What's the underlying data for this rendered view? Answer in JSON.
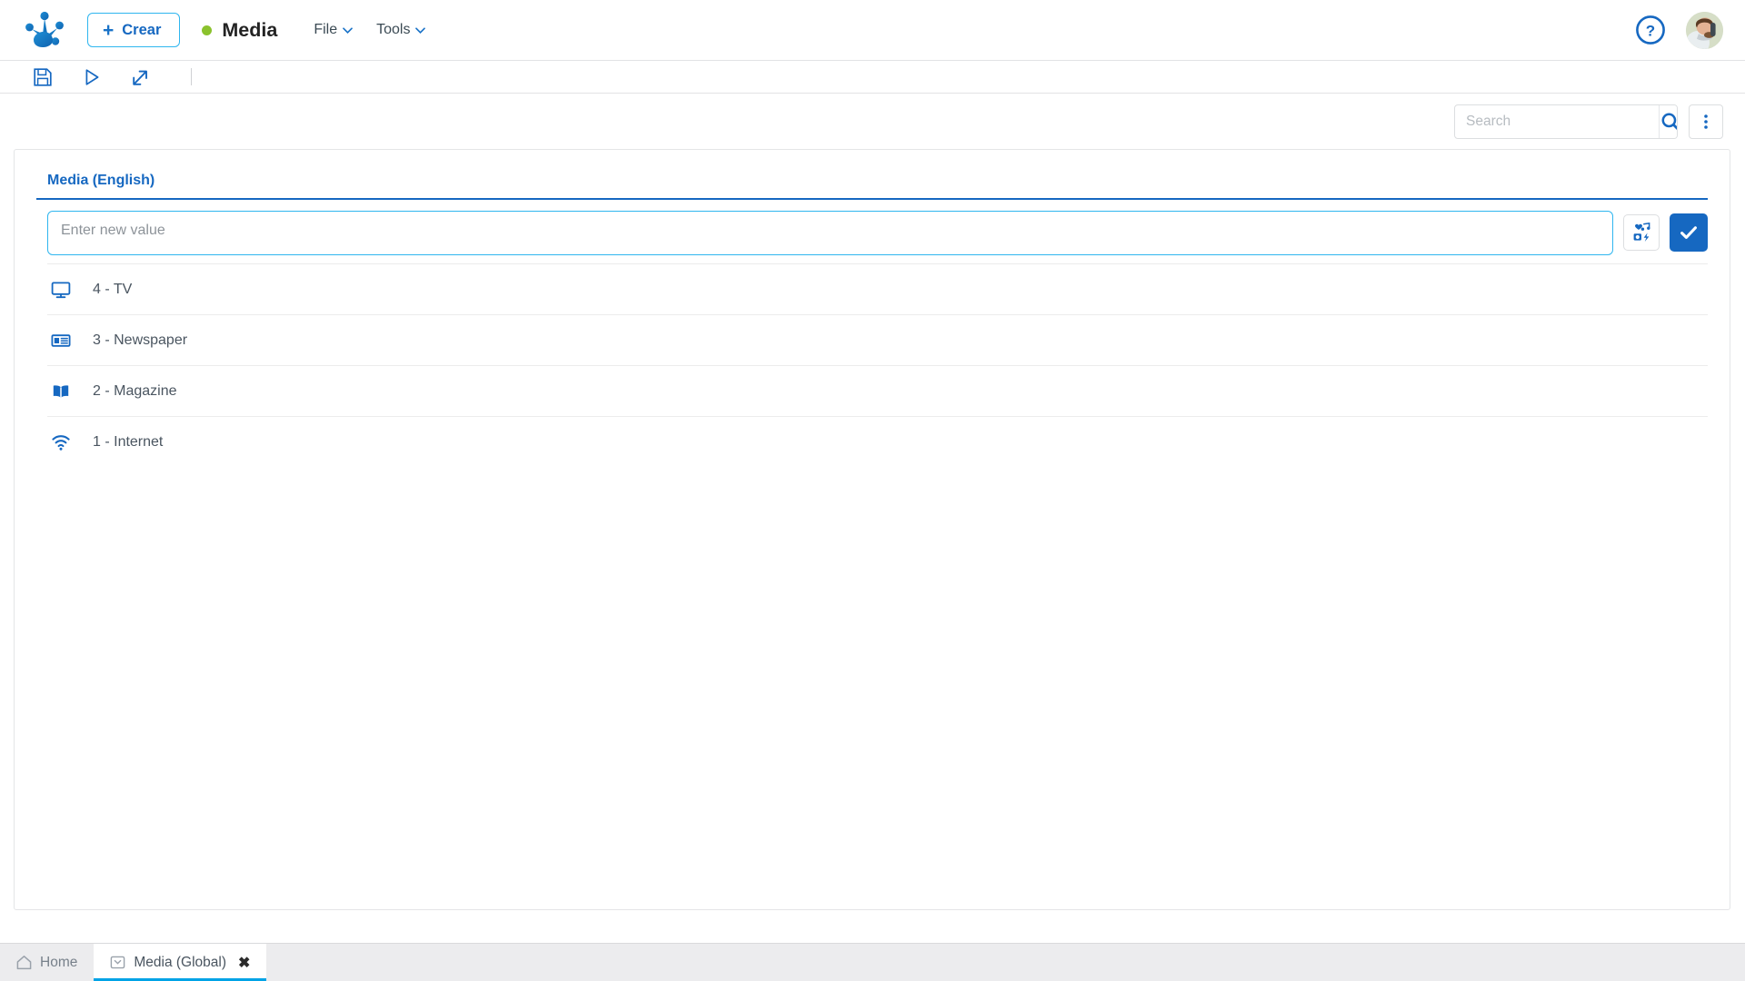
{
  "topbar": {
    "logo_icon": "frog-foot-logo",
    "create_button": {
      "label": "Crear",
      "icon": "plus-icon"
    },
    "document": {
      "title": "Media",
      "status_icon": "status-dot-green",
      "status_color": "#8bc22d"
    },
    "menus": [
      {
        "label": "File",
        "icon": "chevron-down-icon"
      },
      {
        "label": "Tools",
        "icon": "chevron-down-icon"
      }
    ],
    "help_icon": "help-circle-icon",
    "avatar": "user-avatar"
  },
  "toolbar": {
    "buttons": [
      {
        "name": "save-button",
        "icon": "floppy-disk-icon"
      },
      {
        "name": "run-button",
        "icon": "play-triangle-icon"
      },
      {
        "name": "export-button",
        "icon": "export-arrow-icon"
      }
    ]
  },
  "search": {
    "placeholder": "Search",
    "value": "",
    "icon": "search-icon",
    "overflow_icon": "kebab-vertical-icon"
  },
  "panel": {
    "title": "Media (English)",
    "accent_color": "#1668c1",
    "editor": {
      "placeholder": "Enter new value",
      "value": "",
      "media_picker_icon": "media-picker-icon",
      "confirm_icon": "check-icon",
      "confirm_color": "#1668c1",
      "border_color": "#2fb6ef"
    },
    "values": [
      {
        "label": "4 - TV",
        "icon": "tv-monitor-icon"
      },
      {
        "label": "3 - Newspaper",
        "icon": "newspaper-icon"
      },
      {
        "label": "2 - Magazine",
        "icon": "open-book-icon"
      },
      {
        "label": "1 - Internet",
        "icon": "wifi-icon"
      }
    ]
  },
  "taskbar": {
    "tabs": [
      {
        "label": "Home",
        "icon": "home-icon",
        "active": false,
        "closable": false
      },
      {
        "label": "Media (Global)",
        "icon": "window-icon",
        "active": true,
        "closable": true,
        "close_label": "✖"
      }
    ]
  }
}
